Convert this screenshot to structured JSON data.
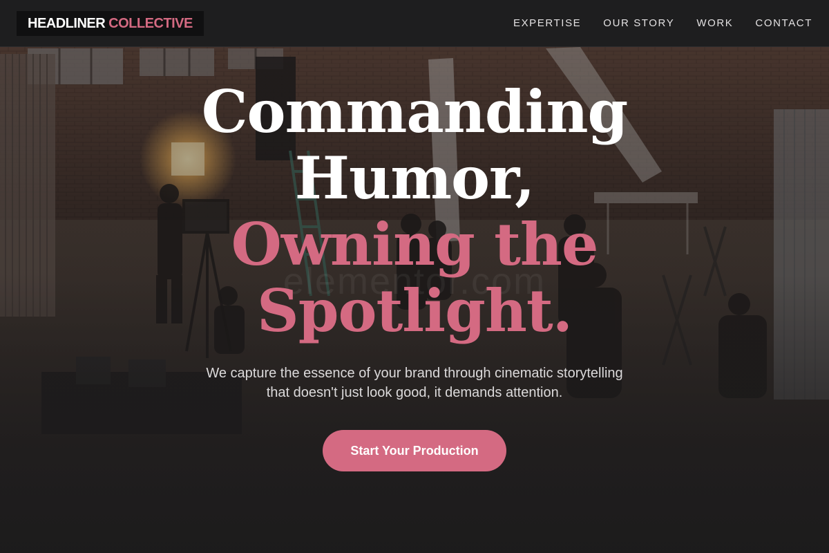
{
  "header": {
    "logo_first": "HEADLINER",
    "logo_second": "COLLECTIVE",
    "nav": [
      {
        "label": "EXPERTISE"
      },
      {
        "label": "OUR STORY"
      },
      {
        "label": "WORK"
      },
      {
        "label": "CONTACT"
      }
    ]
  },
  "hero": {
    "headline_line1": "Commanding",
    "headline_line2": "Humor,",
    "headline_line3": "Owning the",
    "headline_line4": "Spotlight.",
    "subtitle_line1": "We capture the essence of your brand through cinematic storytelling",
    "subtitle_line2": "that doesn't just look good, it demands attention.",
    "cta_label": "Start Your Production",
    "background_image": "film-set-warehouse-photo",
    "watermark": "elementor.com"
  },
  "colors": {
    "accent": "#d46a82",
    "background": "#1c1b1c",
    "header_bg": "#1e1e1f",
    "text_primary": "#ffffff"
  }
}
